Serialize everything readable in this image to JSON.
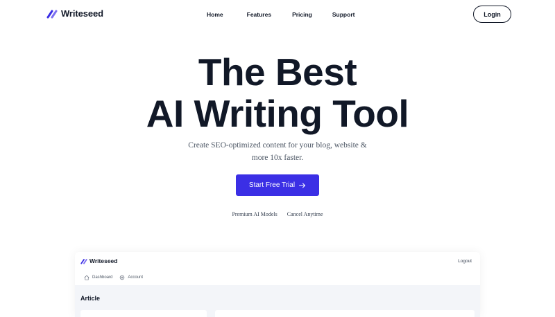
{
  "brand": {
    "name": "Writeseed",
    "accent": "#3b2fe5",
    "logo_icon": "slash-mark-icon"
  },
  "nav": {
    "links": [
      {
        "label": "Home"
      },
      {
        "label": "Features"
      },
      {
        "label": "Pricing"
      },
      {
        "label": "Support"
      }
    ],
    "login_label": "Login"
  },
  "hero": {
    "title_line1": "The Best",
    "title_line2": "AI Writing Tool",
    "subtitle_line1": "Create SEO-optimized content for your blog, website &",
    "subtitle_line2": "more 10x faster.",
    "cta_label": "Start Free Trial",
    "cta_icon": "arrow-right-icon",
    "features": [
      "Premium AI Models",
      "Cancel Anytime"
    ]
  },
  "preview": {
    "brand": "Writeseed",
    "logout_label": "Logout",
    "tabs": [
      {
        "label": "Dashboard",
        "icon": "home-icon"
      },
      {
        "label": "Account",
        "icon": "gear-icon"
      }
    ],
    "section_title": "Article"
  }
}
